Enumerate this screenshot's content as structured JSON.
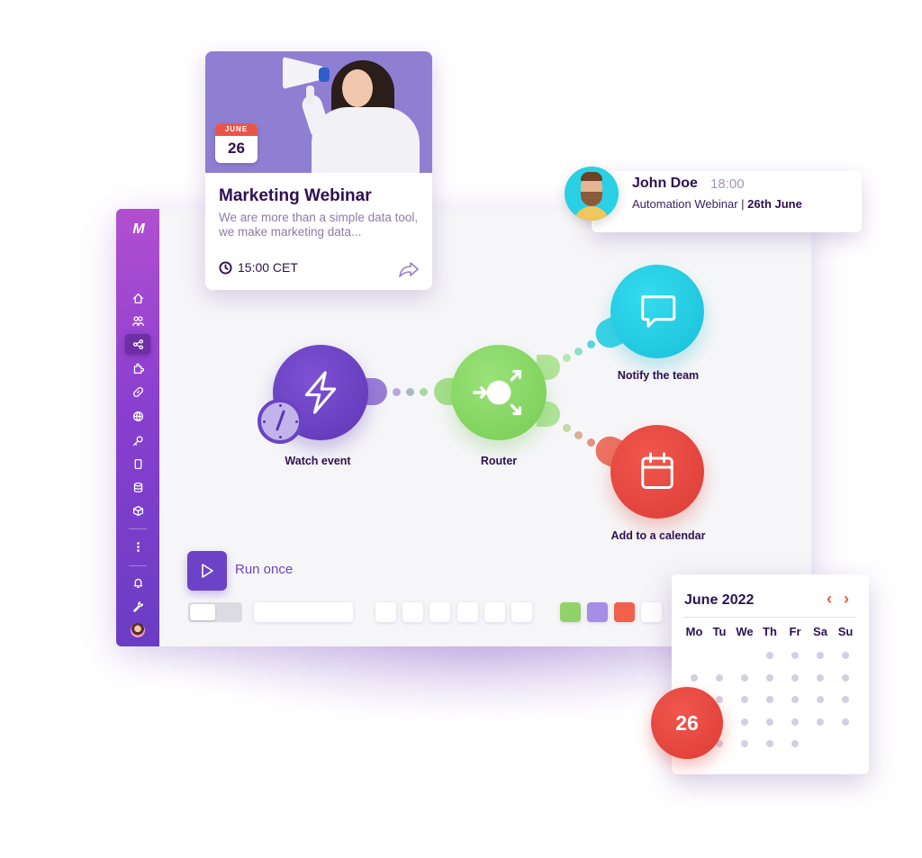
{
  "sidebar": {
    "logo": "M",
    "items": [
      {
        "icon": "home-icon",
        "label": "Home"
      },
      {
        "icon": "team-icon",
        "label": "Team"
      },
      {
        "icon": "share-nodes-icon",
        "label": "Scenarios",
        "active": true
      },
      {
        "icon": "puzzle-icon",
        "label": "Apps"
      },
      {
        "icon": "link-icon",
        "label": "Connections"
      },
      {
        "icon": "globe-icon",
        "label": "Webhooks"
      },
      {
        "icon": "key-icon",
        "label": "Keys"
      },
      {
        "icon": "device-icon",
        "label": "Devices"
      },
      {
        "icon": "database-icon",
        "label": "Data stores"
      },
      {
        "icon": "cube-icon",
        "label": "Data structures"
      },
      {
        "icon": "more-icon",
        "label": "More"
      },
      {
        "icon": "bell-icon",
        "label": "Notifications"
      },
      {
        "icon": "wrench-icon",
        "label": "Settings"
      }
    ]
  },
  "webinar_card": {
    "date_month": "JUNE",
    "date_day": "26",
    "title": "Marketing Webinar",
    "description": "We are more than a simple data tool, we make marketing data...",
    "time": "15:00 CET"
  },
  "notification": {
    "name": "John Doe",
    "time": "18:00",
    "subtitle": "Automation Webinar | ",
    "subtitle_bold": "26th June"
  },
  "modules": [
    {
      "id": "watch",
      "label": "Watch event",
      "color": "#6a43c4"
    },
    {
      "id": "router",
      "label": "Router",
      "color": "#86d862"
    },
    {
      "id": "notify",
      "label": "Notify the team",
      "color": "#22cde4"
    },
    {
      "id": "calendar",
      "label": "Add to a calendar",
      "color": "#e8473f"
    }
  ],
  "toolbar": {
    "run_label": "Run once",
    "swatches": [
      "#93d26a",
      "#a68de6",
      "#f0604c"
    ]
  },
  "calendar": {
    "title": "June 2022",
    "prev": "‹",
    "next": "›",
    "weekdays": [
      "Mo",
      "Tu",
      "We",
      "Th",
      "Fr",
      "Sa",
      "Su"
    ],
    "selected_day": "26"
  },
  "colors": {
    "accent": "#6c42c6",
    "text": "#2e1052",
    "highlight": "#e8564a"
  }
}
